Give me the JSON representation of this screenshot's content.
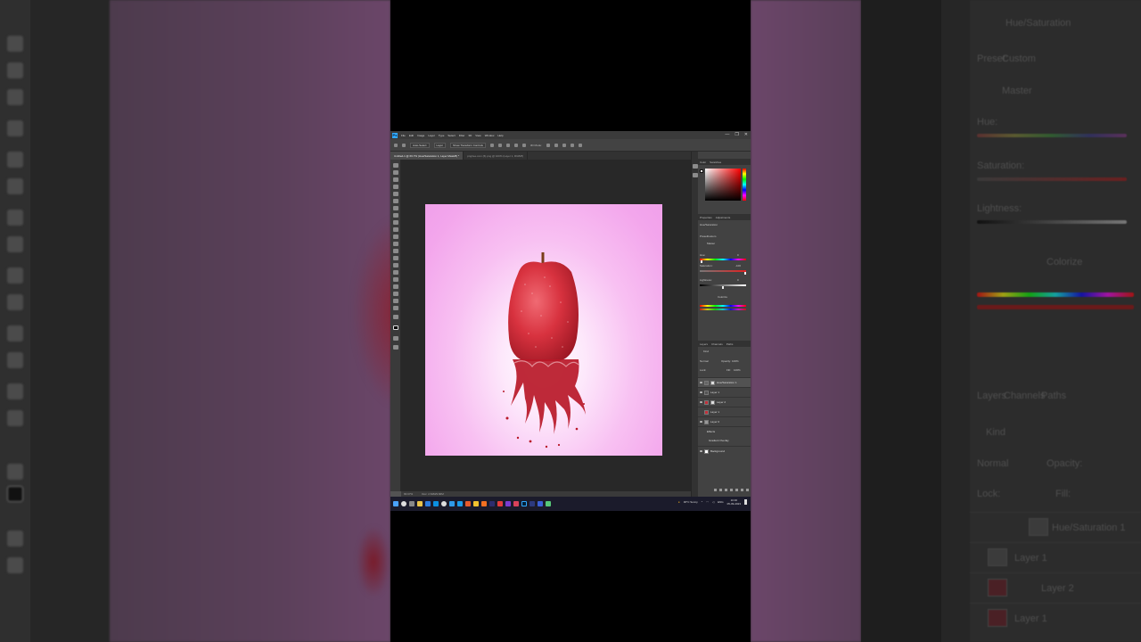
{
  "app": {
    "name": "Adobe Photoshop",
    "logo_text": "Ps",
    "menu": [
      "File",
      "Edit",
      "Image",
      "Layer",
      "Type",
      "Select",
      "Filter",
      "3D",
      "View",
      "Window",
      "Help"
    ],
    "window_controls": [
      "—",
      "❐",
      "✕"
    ]
  },
  "options_bar": {
    "auto_select": "Auto-Select",
    "auto_select_mode": "Layer",
    "show_transform": "Show Transform Controls",
    "mode_3d": "3D Mode:"
  },
  "tabs": [
    {
      "label": "Untitled-1 @ 66.7% (Hue/Saturation 1, Layer Mask/8) *",
      "active": true
    },
    {
      "label": "pngtree.com (6).png @ 100% (Layer 1, RGB/8)",
      "active": false
    }
  ],
  "status": {
    "zoom": "66.67%",
    "doc": "Doc: 2.64M/9.66M"
  },
  "panels": {
    "color_tabs": [
      "Color",
      "Swatches"
    ],
    "properties_tabs": [
      "Properties",
      "Adjustments"
    ],
    "properties_title": "Hue/Saturation",
    "preset_label": "Preset:",
    "preset_value": "Custom",
    "master": "Master",
    "hue_label": "Hue:",
    "hue_value": "0",
    "saturation_label": "Saturation:",
    "saturation_value": "-100",
    "lightness_label": "Lightness:",
    "lightness_value": "0",
    "colorize_label": "Colorize",
    "layers_tabs": [
      "Layers",
      "Channels",
      "Paths"
    ],
    "kind_label": "Kind",
    "blend_mode": "Normal",
    "opacity_label": "Opacity:",
    "opacity_value": "100%",
    "lock_label": "Lock:",
    "fill_label": "Fill:",
    "fill_value": "100%",
    "layers": [
      {
        "name": "Hue/Saturation 1",
        "selected": true
      },
      {
        "name": "Layer 1",
        "selected": false
      },
      {
        "name": "Layer 2",
        "selected": false
      },
      {
        "name": "Layer 1",
        "selected": false
      },
      {
        "name": "Layer 0",
        "selected": false
      },
      {
        "name": "Effects",
        "selected": false
      },
      {
        "name": "Gradient Overlay",
        "selected": false
      },
      {
        "name": "Background",
        "selected": false
      }
    ]
  },
  "taskbar": {
    "weather": "30°C Sunny",
    "time": "10:46",
    "date": "05-09-2023",
    "lang": "ENG"
  },
  "colors": {
    "accent": "#31a8ff",
    "canvas_pink": "#f3a6ec",
    "apple_red": "#d8323f"
  }
}
